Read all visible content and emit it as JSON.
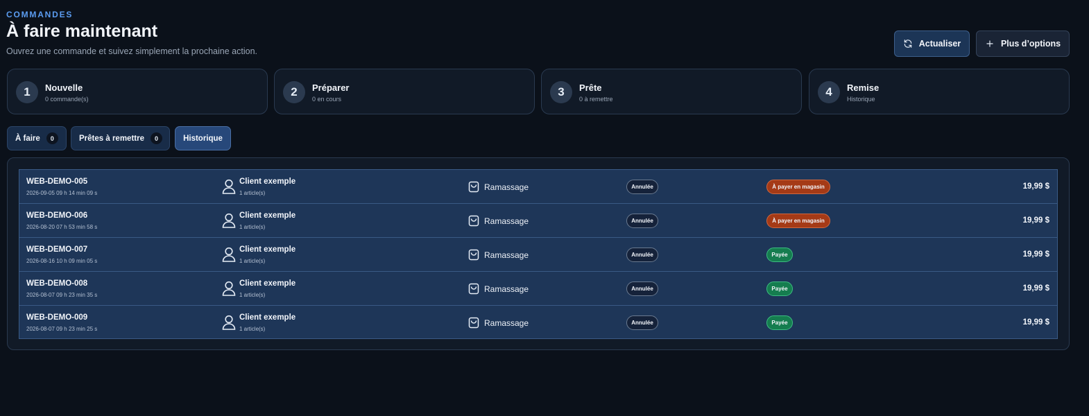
{
  "header": {
    "eyebrow": "COMMANDES",
    "title": "À faire maintenant",
    "subtitle": "Ouvrez une commande et suivez simplement la prochaine action.",
    "refresh_label": "Actualiser",
    "more_label": "Plus d’options"
  },
  "steps": [
    {
      "num": "1",
      "title": "Nouvelle",
      "sub": "0 commande(s)"
    },
    {
      "num": "2",
      "title": "Préparer",
      "sub": "0 en cours"
    },
    {
      "num": "3",
      "title": "Prête",
      "sub": "0 à remettre"
    },
    {
      "num": "4",
      "title": "Remise",
      "sub": "Historique"
    }
  ],
  "tabs": [
    {
      "label": "À faire",
      "count": "0"
    },
    {
      "label": "Prêtes à remettre",
      "count": "0"
    },
    {
      "label": "Historique"
    }
  ],
  "orders": [
    {
      "id": "WEB-DEMO-005",
      "date": "2026-09-05 09 h 14 min 09 s",
      "client": "Client exemple",
      "items": "1 article(s)",
      "mode": "Ramassage",
      "status": "Annulée",
      "payment": "À payer en magasin",
      "payment_kind": "store",
      "amount": "19,99 $"
    },
    {
      "id": "WEB-DEMO-006",
      "date": "2026-08-20 07 h 53 min 58 s",
      "client": "Client exemple",
      "items": "1 article(s)",
      "mode": "Ramassage",
      "status": "Annulée",
      "payment": "À payer en magasin",
      "payment_kind": "store",
      "amount": "19,99 $"
    },
    {
      "id": "WEB-DEMO-007",
      "date": "2026-08-16 10 h 09 min 05 s",
      "client": "Client exemple",
      "items": "1 article(s)",
      "mode": "Ramassage",
      "status": "Annulée",
      "payment": "Payée",
      "payment_kind": "paid",
      "amount": "19,99 $"
    },
    {
      "id": "WEB-DEMO-008",
      "date": "2026-08-07 09 h 23 min 35 s",
      "client": "Client exemple",
      "items": "1 article(s)",
      "mode": "Ramassage",
      "status": "Annulée",
      "payment": "Payée",
      "payment_kind": "paid",
      "amount": "19,99 $"
    },
    {
      "id": "WEB-DEMO-009",
      "date": "2026-08-07 09 h 23 min 25 s",
      "client": "Client exemple",
      "items": "1 article(s)",
      "mode": "Ramassage",
      "status": "Annulée",
      "payment": "Payée",
      "payment_kind": "paid",
      "amount": "19,99 $"
    }
  ],
  "icons": {
    "refresh": "refresh-icon",
    "plus": "plus-icon",
    "user": "user-icon",
    "bag": "shopping-bag-icon"
  },
  "colors": {
    "accent": "#5b9cf0",
    "pay_in_store": "#a53a16",
    "paid": "#157d4f"
  }
}
